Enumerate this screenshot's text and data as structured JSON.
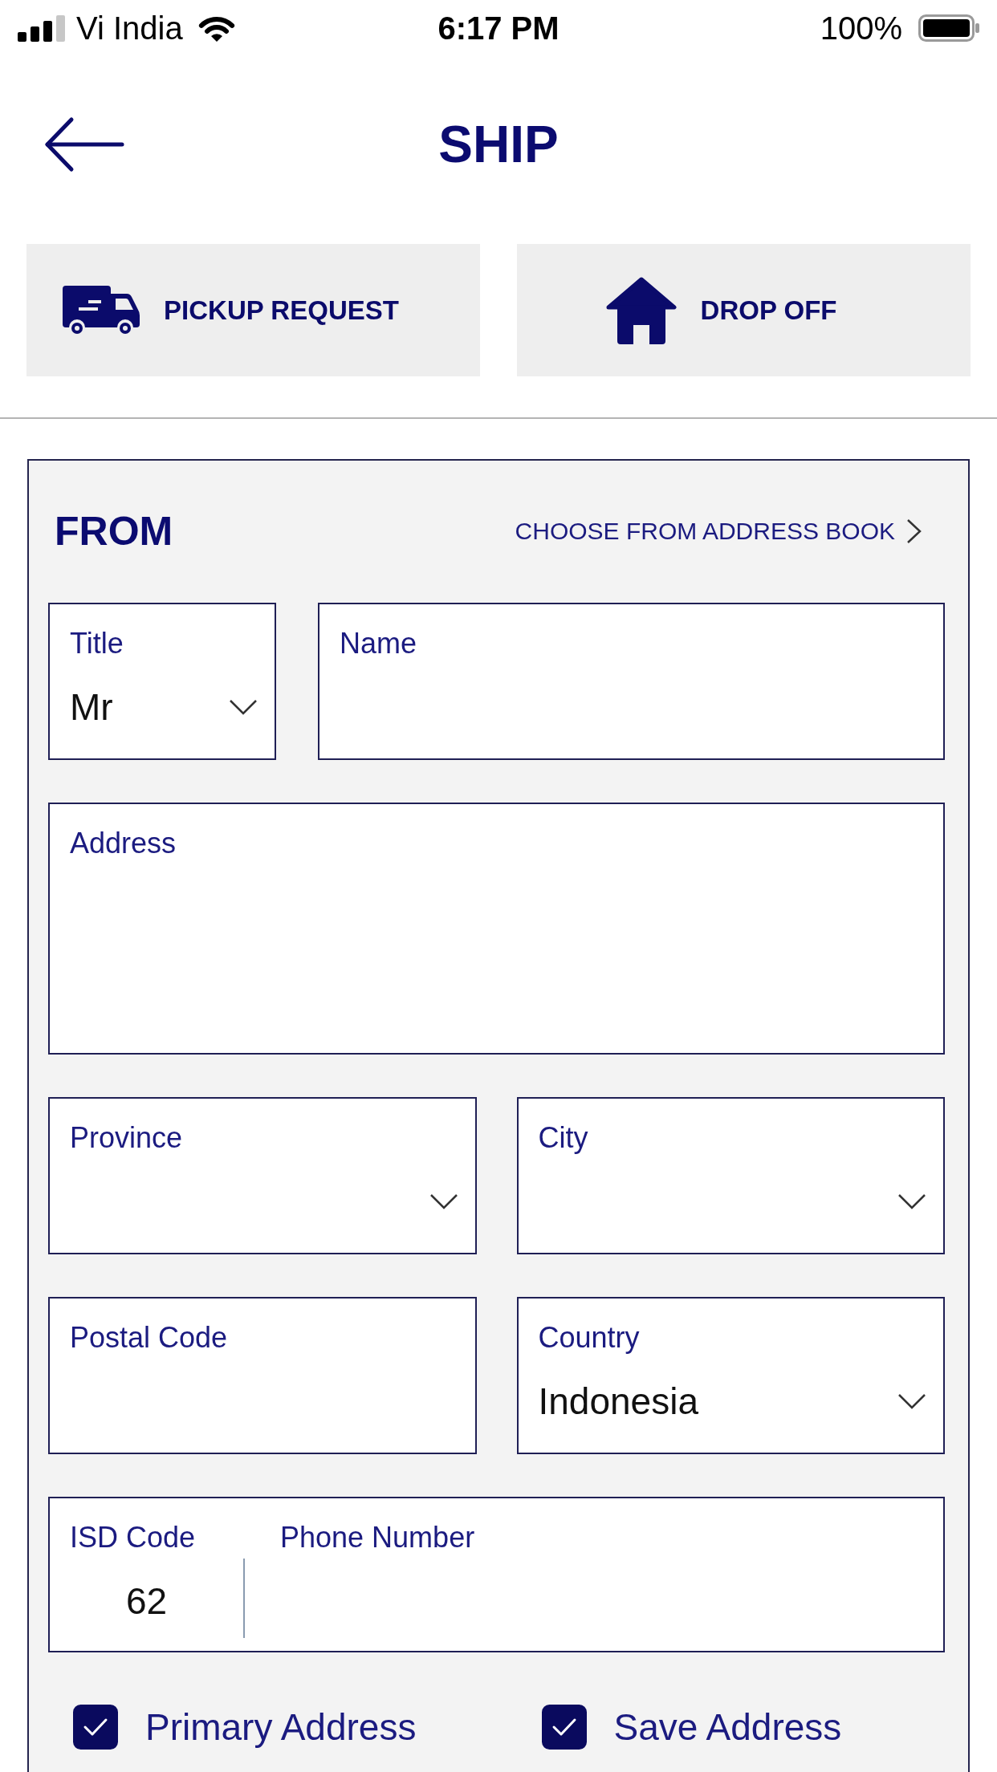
{
  "status_bar": {
    "carrier": "Vi India",
    "time": "6:17 PM",
    "battery": "100%"
  },
  "header": {
    "title": "SHIP"
  },
  "delivery_options": [
    {
      "kind": "truck",
      "label": "PICKUP REQUEST"
    },
    {
      "kind": "house",
      "label": "DROP OFF"
    }
  ],
  "from_section": {
    "title": "FROM",
    "address_book_link": "CHOOSE FROM ADDRESS BOOK",
    "field_rows": [
      [
        {
          "kind": "dropdown",
          "label": "Title",
          "value": "Mr"
        },
        {
          "kind": "text",
          "label": "Name"
        }
      ],
      [
        {
          "kind": "textarea",
          "label": "Address"
        }
      ],
      [
        {
          "kind": "dropdown",
          "label": "Province"
        },
        {
          "kind": "dropdown",
          "label": "City"
        }
      ],
      [
        {
          "kind": "text",
          "label": "Postal Code"
        },
        {
          "kind": "dropdown",
          "label": "Country",
          "value": "Indonesia"
        }
      ]
    ],
    "phone": {
      "isd_label": "ISD Code",
      "isd_value": "62",
      "number_label": "Phone Number"
    },
    "checkboxes": [
      {
        "label": "Primary Address",
        "checked": true
      },
      {
        "label": "Save Address",
        "checked": true
      }
    ]
  }
}
